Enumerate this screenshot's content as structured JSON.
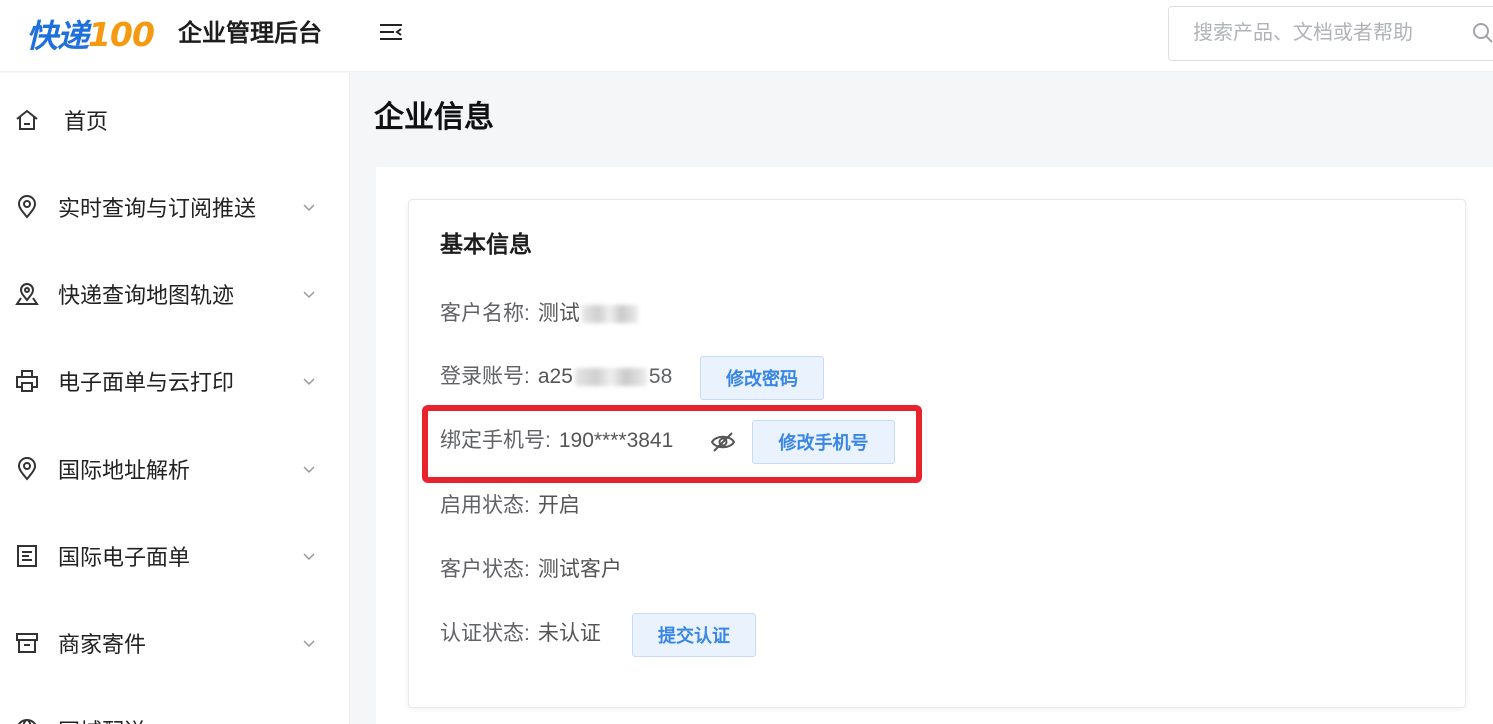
{
  "header": {
    "logo_main": "快递",
    "logo_num": "100",
    "app_title": "企业管理后台",
    "search_placeholder": "搜索产品、文档或者帮助"
  },
  "sidebar": {
    "items": [
      {
        "label": "首页",
        "icon": "home-icon",
        "expandable": false
      },
      {
        "label": "实时查询与订阅推送",
        "icon": "location-pin-icon",
        "expandable": true
      },
      {
        "label": "快递查询地图轨迹",
        "icon": "map-pin-icon",
        "expandable": true
      },
      {
        "label": "电子面单与云打印",
        "icon": "printer-icon",
        "expandable": true
      },
      {
        "label": "国际地址解析",
        "icon": "location-pin-icon",
        "expandable": true
      },
      {
        "label": "国际电子面单",
        "icon": "document-icon",
        "expandable": true
      },
      {
        "label": "商家寄件",
        "icon": "archive-box-icon",
        "expandable": true
      },
      {
        "label": "同城配送",
        "icon": "globe-icon",
        "expandable": false
      }
    ]
  },
  "main": {
    "page_title": "企业信息",
    "section_title": "基本信息",
    "customer_name": {
      "label": "客户名称:",
      "value": "测试"
    },
    "login_account": {
      "label": "登录账号:",
      "value_prefix": "a25",
      "value_suffix": "58",
      "button": "修改密码"
    },
    "bound_phone": {
      "label": "绑定手机号:",
      "value": "190****3841",
      "button": "修改手机号"
    },
    "enable_status": {
      "label": "启用状态:",
      "value": "开启"
    },
    "customer_status": {
      "label": "客户状态:",
      "value": "测试客户"
    },
    "auth_status": {
      "label": "认证状态:",
      "value": "未认证",
      "button": "提交认证"
    }
  },
  "colors": {
    "brand_blue": "#1f6fdc",
    "brand_orange": "#f59a10",
    "highlight_red": "#e8232e",
    "button_text": "#3a86e6"
  }
}
